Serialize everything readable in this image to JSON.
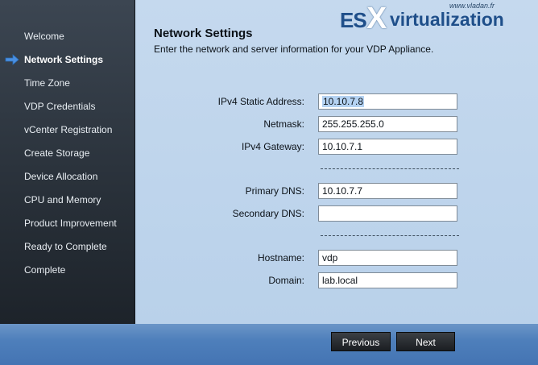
{
  "sidebar": {
    "items": [
      {
        "label": "Welcome"
      },
      {
        "label": "Network Settings"
      },
      {
        "label": "Time Zone"
      },
      {
        "label": "VDP Credentials"
      },
      {
        "label": "vCenter Registration"
      },
      {
        "label": "Create Storage"
      },
      {
        "label": "Device Allocation"
      },
      {
        "label": "CPU and Memory"
      },
      {
        "label": "Product Improvement"
      },
      {
        "label": "Ready to Complete"
      },
      {
        "label": "Complete"
      }
    ],
    "active_index": 1,
    "active_icon": "right-arrow-icon"
  },
  "header": {
    "title": "Network Settings",
    "subtitle": "Enter the network and server information for your VDP Appliance."
  },
  "form": {
    "ipv4_static": {
      "label": "IPv4 Static Address:",
      "value": "10.10.7.8"
    },
    "netmask": {
      "label": "Netmask:",
      "value": "255.255.255.0"
    },
    "ipv4_gateway": {
      "label": "IPv4 Gateway:",
      "value": "10.10.7.1"
    },
    "primary_dns": {
      "label": "Primary DNS:",
      "value": "10.10.7.7"
    },
    "secondary_dns": {
      "label": "Secondary DNS:",
      "value": ""
    },
    "hostname": {
      "label": "Hostname:",
      "value": "vdp"
    },
    "domain": {
      "label": "Domain:",
      "value": "lab.local"
    }
  },
  "watermark": {
    "small": "www.vladan.fr",
    "es": "ES",
    "x": "X",
    "rest": "virtualization"
  },
  "footer": {
    "previous_label": "Previous",
    "next_label": "Next"
  },
  "colors": {
    "sidebar_bg": "#2a323b",
    "content_bg": "#c5d9ee",
    "footer_bg": "#4e7fbb",
    "arrow": "#4a90e2"
  }
}
